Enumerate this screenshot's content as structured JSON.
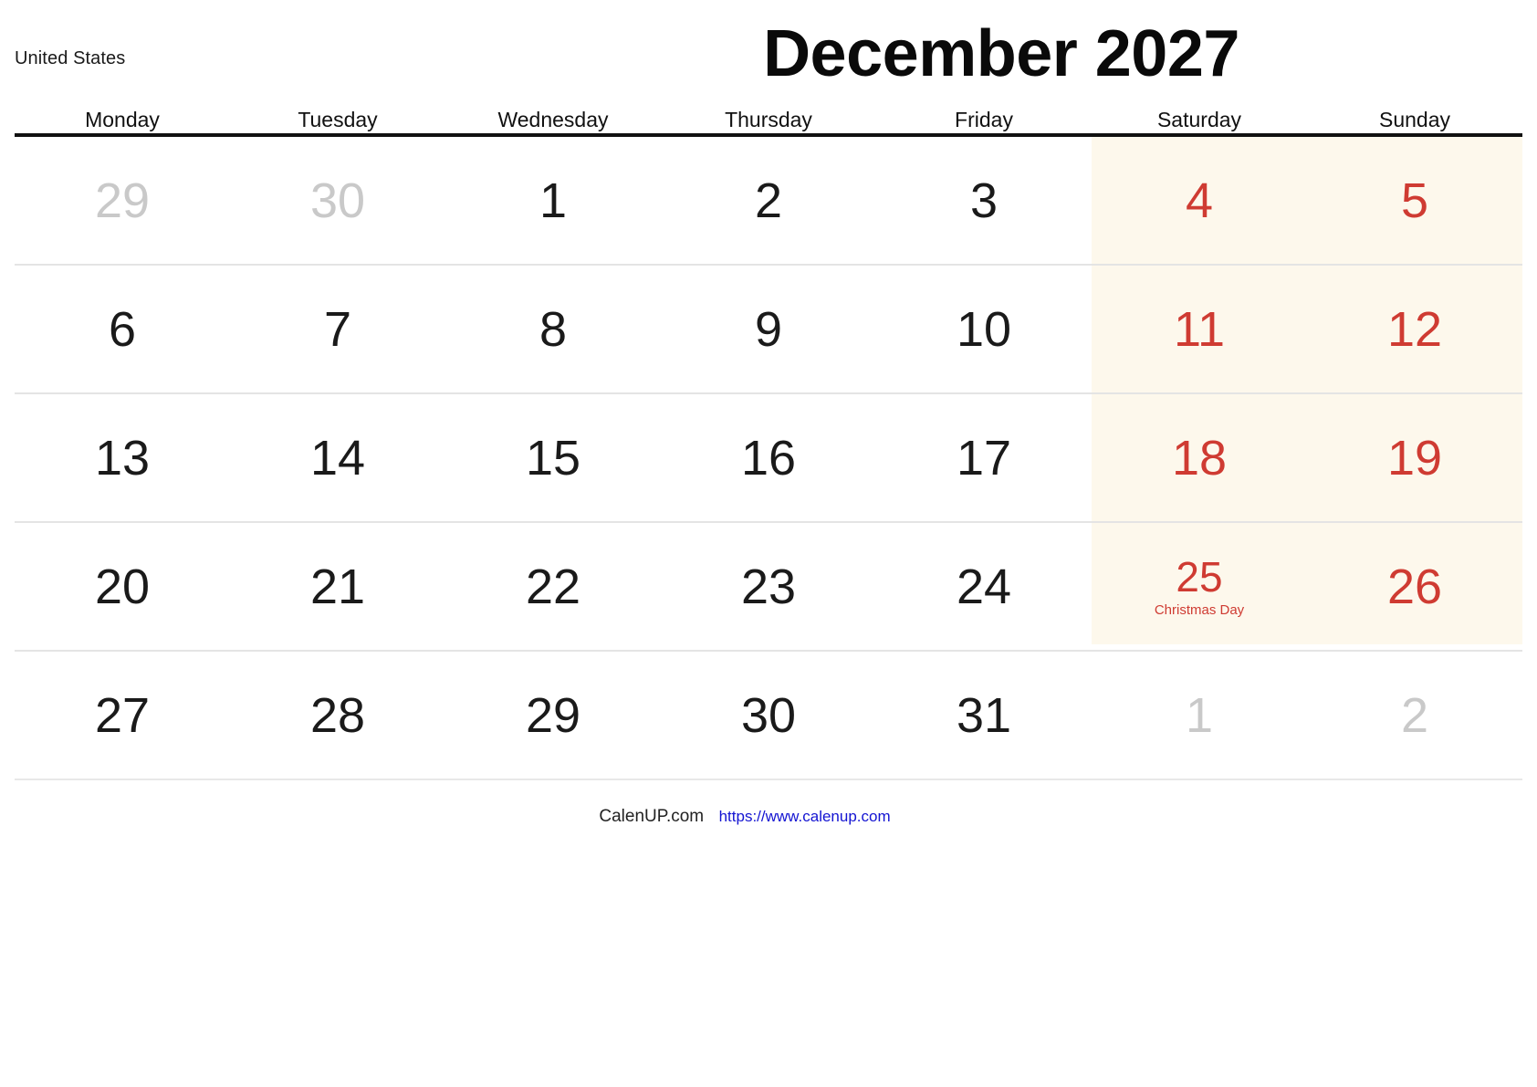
{
  "header": {
    "country": "United States",
    "title": "December 2027"
  },
  "weekdays": [
    "Monday",
    "Tuesday",
    "Wednesday",
    "Thursday",
    "Friday",
    "Saturday",
    "Sunday"
  ],
  "colors": {
    "weekend_text": "#cf3b32",
    "weekend_background": "#fdf8ec",
    "outside_month_text": "#c9c9c9",
    "day_text": "#1a1a1a",
    "header_rule": "#111111",
    "row_separator": "#e4e4e4",
    "link": "#1414d2"
  },
  "weeks": [
    [
      {
        "day": "29",
        "type": "out"
      },
      {
        "day": "30",
        "type": "out"
      },
      {
        "day": "1",
        "type": "day"
      },
      {
        "day": "2",
        "type": "day"
      },
      {
        "day": "3",
        "type": "day"
      },
      {
        "day": "4",
        "type": "weekend"
      },
      {
        "day": "5",
        "type": "weekend"
      }
    ],
    [
      {
        "day": "6",
        "type": "day"
      },
      {
        "day": "7",
        "type": "day"
      },
      {
        "day": "8",
        "type": "day"
      },
      {
        "day": "9",
        "type": "day"
      },
      {
        "day": "10",
        "type": "day"
      },
      {
        "day": "11",
        "type": "weekend"
      },
      {
        "day": "12",
        "type": "weekend"
      }
    ],
    [
      {
        "day": "13",
        "type": "day"
      },
      {
        "day": "14",
        "type": "day"
      },
      {
        "day": "15",
        "type": "day"
      },
      {
        "day": "16",
        "type": "day"
      },
      {
        "day": "17",
        "type": "day"
      },
      {
        "day": "18",
        "type": "weekend"
      },
      {
        "day": "19",
        "type": "weekend"
      }
    ],
    [
      {
        "day": "20",
        "type": "day"
      },
      {
        "day": "21",
        "type": "day"
      },
      {
        "day": "22",
        "type": "day"
      },
      {
        "day": "23",
        "type": "day"
      },
      {
        "day": "24",
        "type": "day"
      },
      {
        "day": "25",
        "type": "holiday",
        "label": "Christmas Day"
      },
      {
        "day": "26",
        "type": "weekend"
      }
    ],
    [
      {
        "day": "27",
        "type": "day"
      },
      {
        "day": "28",
        "type": "day"
      },
      {
        "day": "29",
        "type": "day"
      },
      {
        "day": "30",
        "type": "day"
      },
      {
        "day": "31",
        "type": "day"
      },
      {
        "day": "1",
        "type": "out"
      },
      {
        "day": "2",
        "type": "out"
      }
    ]
  ],
  "footer": {
    "brand": "CalenUP.com",
    "url": "https://www.calenup.com"
  }
}
